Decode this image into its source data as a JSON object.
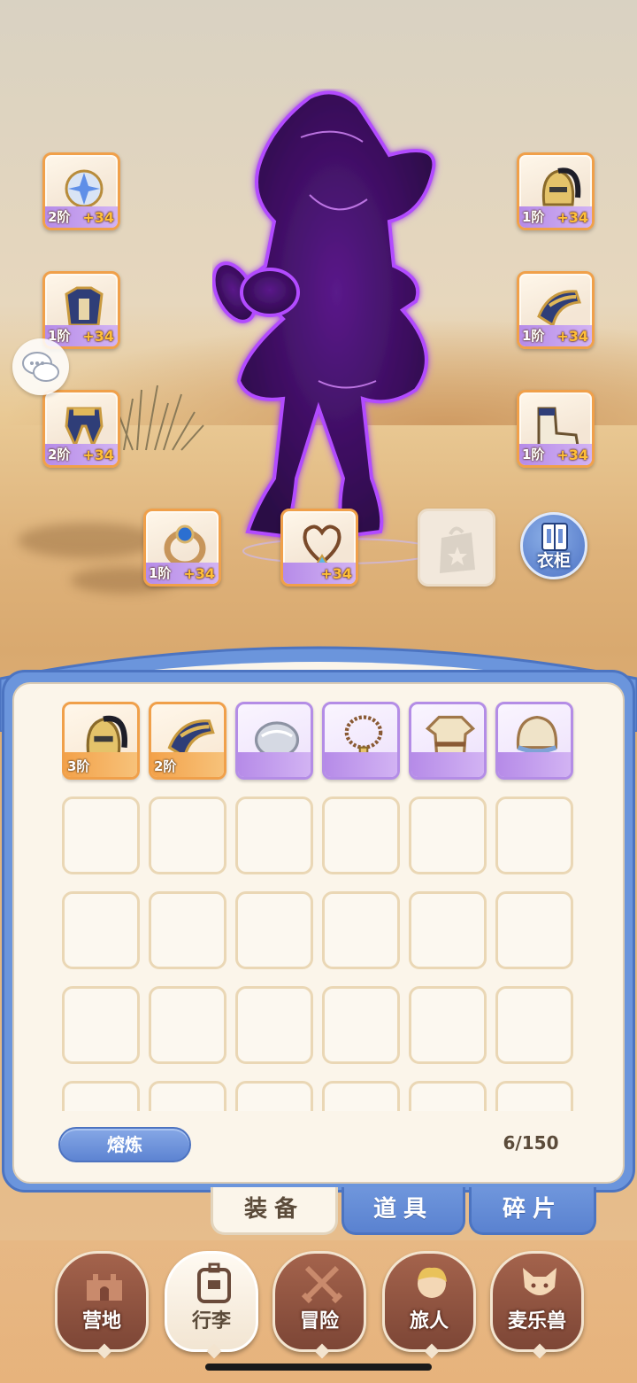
{
  "equipped": {
    "left": [
      {
        "name": "amulet",
        "tier": "2阶",
        "bonus": "+34"
      },
      {
        "name": "chest-armor",
        "tier": "1阶",
        "bonus": "+34"
      },
      {
        "name": "leg-armor",
        "tier": "2阶",
        "bonus": "+34"
      }
    ],
    "right": [
      {
        "name": "helmet",
        "tier": "1阶",
        "bonus": "+34"
      },
      {
        "name": "gauntlet",
        "tier": "1阶",
        "bonus": "+34"
      },
      {
        "name": "boots",
        "tier": "1阶",
        "bonus": "+34"
      }
    ],
    "bottom": [
      {
        "name": "ring",
        "tier": "1阶",
        "bonus": "+34"
      },
      {
        "name": "necklace",
        "tier": "",
        "bonus": "+34"
      }
    ]
  },
  "wardrobe_label": "衣柜",
  "inventory": {
    "items": [
      {
        "name": "helmet",
        "rarity": "orange",
        "tier": "3阶"
      },
      {
        "name": "gauntlet",
        "rarity": "orange",
        "tier": "2阶"
      },
      {
        "name": "silver-pauldron",
        "rarity": "purple",
        "tier": ""
      },
      {
        "name": "leather-necklace",
        "rarity": "purple",
        "tier": ""
      },
      {
        "name": "tunic",
        "rarity": "purple",
        "tier": ""
      },
      {
        "name": "cloth-cap",
        "rarity": "purple",
        "tier": ""
      }
    ],
    "smelt_label": "熔炼",
    "capacity": "6/150"
  },
  "tabs": [
    "装备",
    "道具",
    "碎片"
  ],
  "nav": [
    "营地",
    "行李",
    "冒险",
    "旅人",
    "麦乐兽"
  ],
  "colors": {
    "accent_blue": "#6b95dc",
    "orange_rarity": "#f0a04a",
    "purple_rarity": "#b48de6",
    "character_glow": "#9b30ff"
  }
}
